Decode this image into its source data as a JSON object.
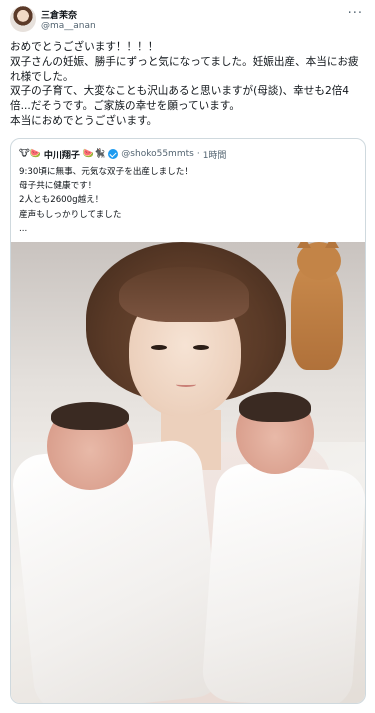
{
  "author": {
    "name": "三倉茉奈",
    "handle": "@ma__anan"
  },
  "tweet": {
    "lines": [
      "おめでとうございます！！！！",
      "双子さんの妊娠、勝手にずっと気になってました。妊娠出産、本当にお疲",
      "れ様でした。",
      "双子の子育て、大変なことも沢山あると思いますが(母談)、幸せも2倍4",
      "倍...だそうです。ご家族の幸せを願っています。",
      "本当におめでとうございます。"
    ]
  },
  "quote": {
    "emoji_prefix": "🐮🍉",
    "name": "中川翔子",
    "emoji_suffix": "🍉🐈‍⬛",
    "handle": "@shoko55mmts",
    "separator": "·",
    "time": "1時間",
    "lines": [
      "9:30頃に無事、元気な双子を出産しました！",
      "母子共に健康です！",
      "2人とも2600g越え！",
      "産声もしっかりしてました",
      "..."
    ]
  },
  "icons": {
    "more": "more-icon",
    "verified": "verified-badge-icon"
  },
  "colors": {
    "text": "#0f1419",
    "secondary": "#536471",
    "border": "#cfd9de",
    "verified": "#1d9bf0"
  }
}
